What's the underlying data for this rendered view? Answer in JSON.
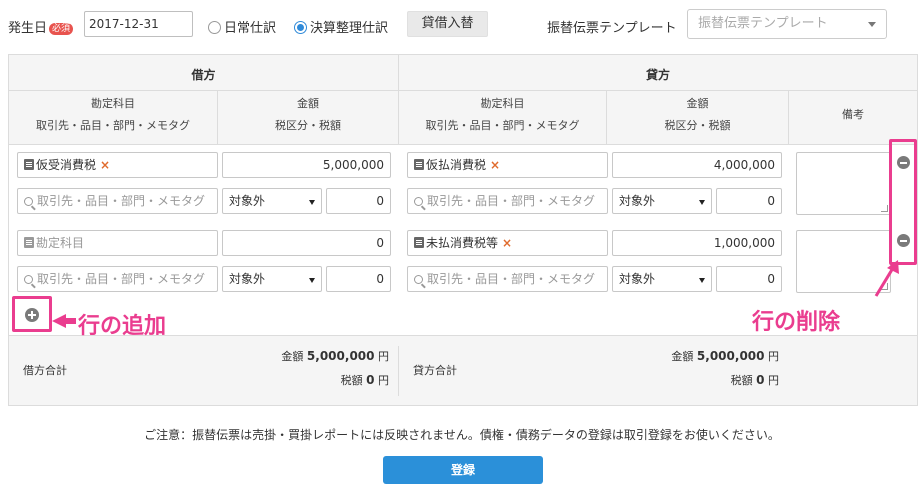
{
  "top": {
    "date_label": "発生日",
    "required_badge": "必須",
    "date_value": "2017-12-31",
    "radio_daily": "日常仕訳",
    "radio_closing": "決算整理仕訳",
    "swap_button": "貸借入替",
    "template_label": "振替伝票テンプレート",
    "template_placeholder": "振替伝票テンプレート"
  },
  "table": {
    "debit_header": "借方",
    "credit_header": "貸方",
    "col_account": "勘定科目",
    "col_account_sub": "取引先・品目・部門・メモタグ",
    "col_amount": "金額",
    "col_amount_sub": "税区分・税額",
    "col_memo": "備考",
    "rows": [
      {
        "debit_account": "仮受消費税",
        "debit_amount": "5,000,000",
        "debit_tag_placeholder": "取引先・品目・部門・メモタグ",
        "debit_tax": "対象外",
        "debit_tax_amount": "0",
        "credit_account": "仮払消費税",
        "credit_amount": "4,000,000",
        "credit_tag_placeholder": "取引先・品目・部門・メモタグ",
        "credit_tax": "対象外",
        "credit_tax_amount": "0"
      },
      {
        "debit_account_placeholder": "勘定科目",
        "debit_amount": "0",
        "debit_tag_placeholder": "取引先・品目・部門・メモタグ",
        "debit_tax": "対象外",
        "debit_tax_amount": "0",
        "credit_account": "未払消費税等",
        "credit_amount": "1,000,000",
        "credit_tag_placeholder": "取引先・品目・部門・メモタグ",
        "credit_tax": "対象外",
        "credit_tax_amount": "0"
      }
    ],
    "remove_x": "×"
  },
  "annotations": {
    "add_row": "行の追加",
    "delete_row": "行の削除"
  },
  "totals": {
    "debit_label": "借方合計",
    "credit_label": "貸方合計",
    "amount_label": "金額",
    "tax_label": "税額",
    "debit_amount": "5,000,000",
    "debit_tax": "0",
    "credit_amount": "5,000,000",
    "credit_tax": "0",
    "unit": "円"
  },
  "footer": {
    "note": "ご注意：振替伝票は売掛・買掛レポートには反映されません。債権・債務データの登録は取引登録をお使いください。",
    "submit": "登録"
  },
  "colors": {
    "accent": "#2b90d9",
    "annotation": "#ea3d8f",
    "remove_x": "#e06b2d",
    "required": "#e8534e"
  }
}
